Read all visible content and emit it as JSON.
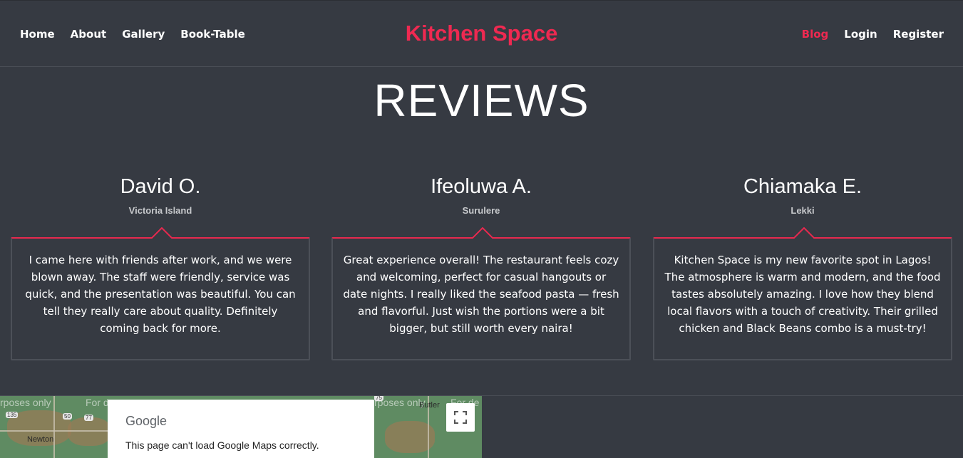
{
  "nav": {
    "left": [
      "Home",
      "About",
      "Gallery",
      "Book-Table"
    ],
    "brand": "Kitchen Space",
    "right": [
      "Blog",
      "Login",
      "Register"
    ]
  },
  "page_title": "REVIEWS",
  "reviews": [
    {
      "name": "David O.",
      "place": "Victoria Island",
      "text": "I came here with friends after work, and we were blown away. The staff were friendly, service was quick, and the presentation was beautiful. You can tell they really care about quality. Definitely coming back for more."
    },
    {
      "name": "Ifeoluwa A.",
      "place": "Surulere",
      "text": "Great experience overall! The restaurant feels cozy and welcoming, perfect for casual hangouts or date nights. I really liked the seafood pasta — fresh and flavorful. Just wish the portions were a bit bigger, but still worth every naira!"
    },
    {
      "name": "Chiamaka E.",
      "place": "Lekki",
      "text": "Kitchen Space is my new favorite spot in Lagos! The atmosphere is warm and modern, and the food tastes absolutely amazing. I love how they blend local flavors with a touch of creativity. Their grilled chicken and Black Beans combo is a must-try!"
    }
  ],
  "map": {
    "overlay_texts": [
      "rposes only",
      "For d",
      "rposes only",
      "For de"
    ],
    "cities": [
      "Newton",
      "Butler"
    ],
    "shields": [
      "135",
      "50",
      "77",
      "75"
    ],
    "dialog_brand": "Google",
    "dialog_message": "This page can't load Google Maps correctly."
  },
  "colors": {
    "background": "#363a42",
    "accent": "#ef2951",
    "card_border": "#4c5058"
  }
}
